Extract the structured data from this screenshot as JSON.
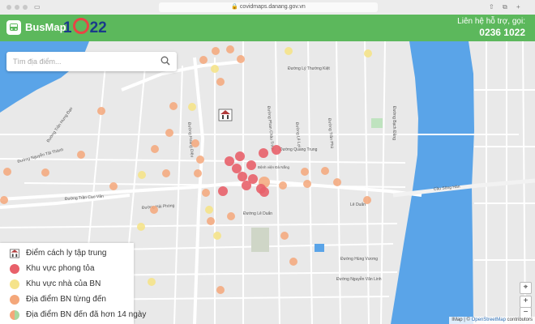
{
  "browser": {
    "url": "covidmaps.danang.gov.vn"
  },
  "header": {
    "app_name": "BusMap",
    "badge_prefix": "1",
    "badge_suffix": "22",
    "support_line1": "Liên hệ hỗ trợ, gọi:",
    "support_phone": "0236 1022",
    "color": "#5cb85c"
  },
  "search": {
    "placeholder": "Tìm địa điểm..."
  },
  "legend": {
    "items": [
      {
        "label": "Điểm cách ly tập trung",
        "icon": "quarantine-building-icon"
      },
      {
        "label": "Khu vực phong tỏa",
        "color": "#e8606a"
      },
      {
        "label": "Khu vực nhà của BN",
        "color": "#f5e38a"
      },
      {
        "label": "Địa điểm BN từng đến",
        "color": "#f4a77a"
      },
      {
        "label": "Địa điểm BN đến đã hơn 14 ngày",
        "color": "#f4a77a"
      }
    ]
  },
  "map": {
    "street_labels": [
      "Đường Nguyễn Tất Thành",
      "Đường Trần Cao Vân",
      "Đường Hải Phòng",
      "Đường Lê Duẩn",
      "Đường Quang Trung",
      "Đường Lý Thường Kiệt",
      "Đường Hùng Vương",
      "Đường Nguyễn Văn Linh",
      "Đường Bạch Đằng",
      "Đường Trần Phú",
      "Đường Lê Lợi",
      "Đường Phan Châu Trinh",
      "Cầu Sông Hàn",
      "Lê Duẩn",
      "Đường Hoàng Diệu",
      "Đường Trần Hưng Đạo",
      "Bệnh viện Đà Nẵng"
    ],
    "attribution_prefix": "IMap",
    "attribution_link": "OpenStreetMap",
    "attribution_suffix": "contributors",
    "water_color": "#5aa4e8",
    "land_color": "#e9e9e9",
    "marker_colors": {
      "lockdown": "#e8606a",
      "home": "#f5e38a",
      "visited": "#f4a77a"
    }
  }
}
